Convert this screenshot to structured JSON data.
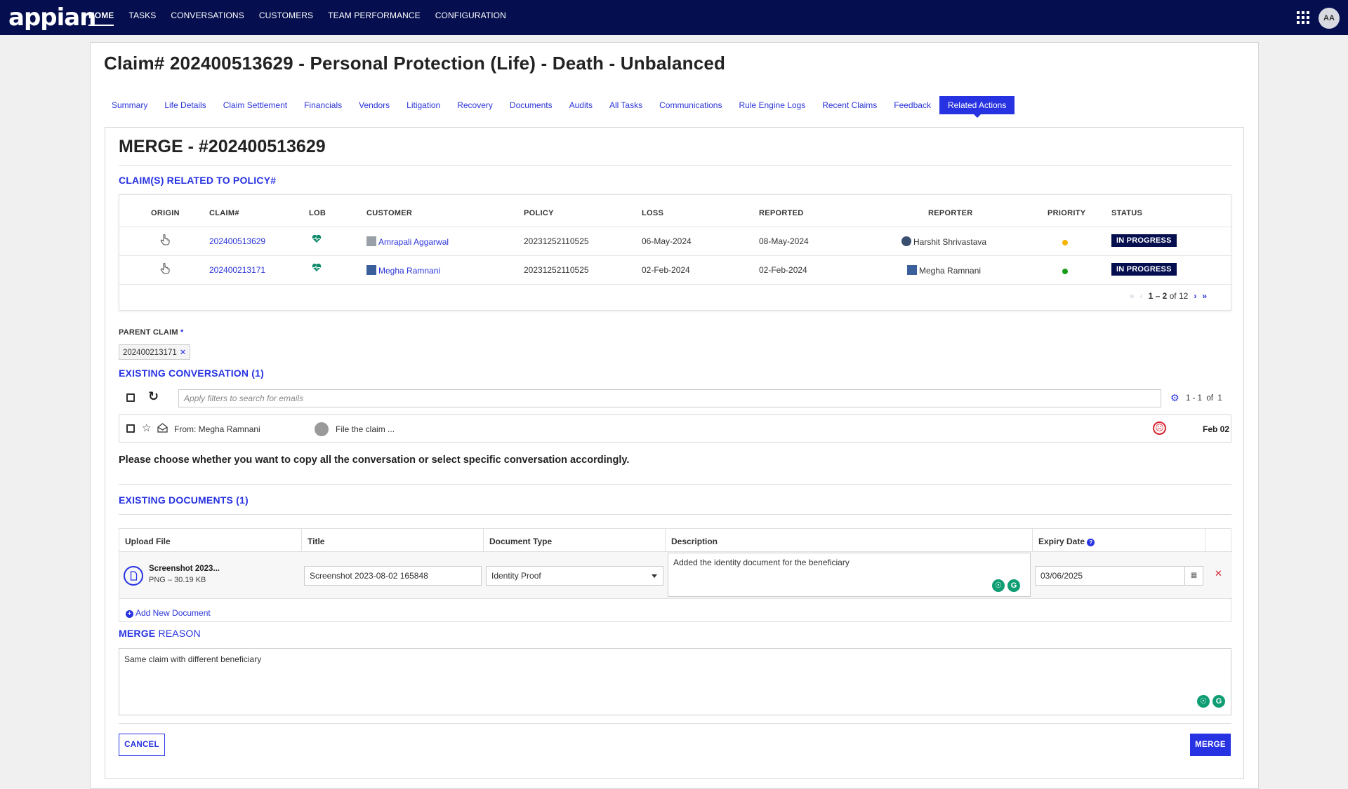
{
  "app": {
    "logo": "appian",
    "nav": [
      "HOME",
      "TASKS",
      "CONVERSATIONS",
      "CUSTOMERS",
      "TEAM PERFORMANCE",
      "CONFIGURATION"
    ],
    "active_nav": "HOME",
    "user_initials": "AA",
    "apps_icon": "grid-icon"
  },
  "page": {
    "title": "Claim# 202400513629 - Personal Protection (Life) - Death - Unbalanced",
    "tabs": [
      "Summary",
      "Life Details",
      "Claim Settlement",
      "Financials",
      "Vendors",
      "Litigation",
      "Recovery",
      "Documents",
      "Audits",
      "All Tasks",
      "Communications",
      "Rule Engine Logs",
      "Recent Claims",
      "Feedback",
      "Related Actions"
    ],
    "active_tab": "Related Actions"
  },
  "merge": {
    "title": "MERGE - #202400513629",
    "related_title": "CLAIM(S) RELATED TO POLICY#",
    "columns": [
      "ORIGIN",
      "CLAIM#",
      "LOB",
      "CUSTOMER",
      "POLICY",
      "LOSS",
      "REPORTED",
      "REPORTER",
      "PRIORITY",
      "STATUS"
    ],
    "rows": [
      {
        "origin_icon": "hand-pointer-icon",
        "claim": "202400513629",
        "lob_icon": "heart-pulse-icon",
        "customer": "Amrapali Aggarwal",
        "policy": "20231252110525",
        "loss": "06-May-2024",
        "reported": "08-May-2024",
        "reporter": "Harshit Shrivastava",
        "priority_color": "#f5b400",
        "status": "IN PROGRESS"
      },
      {
        "origin_icon": "hand-pointer-icon",
        "claim": "202400213171",
        "lob_icon": "heart-pulse-icon",
        "customer": "Megha Ramnani",
        "policy": "20231252110525",
        "loss": "02-Feb-2024",
        "reported": "02-Feb-2024",
        "reporter": "Megha Ramnani",
        "priority_color": "#1a9c1a",
        "status": "IN PROGRESS"
      }
    ],
    "pager": {
      "range": "1 – 2",
      "of": "of 12"
    },
    "parent_claim_label": "PARENT CLAIM",
    "parent_claim_required": "*",
    "parent_claim_value": "202400213171",
    "conversation_title": "EXISTING CONVERSATION (1)",
    "search_placeholder": "Apply filters to search for emails",
    "conv_count": "1 - 1  of  1",
    "conversation": {
      "from": "From: Megha Ramnani",
      "subject": "File the claim ...",
      "date": "Feb 02"
    },
    "instruction": "Please choose whether you want to copy all the conversation or select specific conversation accordingly.",
    "documents_title": "EXISTING DOCUMENTS (1)",
    "doc_columns": [
      "Upload File",
      "Title",
      "Document Type",
      "Description",
      "Expiry Date"
    ],
    "document": {
      "file_name": "Screenshot 2023...",
      "file_meta": "PNG – 30.19 KB",
      "title": "Screenshot 2023-08-02 165848",
      "doc_type": "Identity Proof",
      "description": "Added the identity document for the beneficiary",
      "expiry": "03/06/2025"
    },
    "add_document": "Add New Document",
    "reason_title_a": "MERGE",
    "reason_title_b": "REASON",
    "reason_text": "Same claim with different beneficiary",
    "cancel_label": "CANCEL",
    "merge_label": "MERGE"
  }
}
